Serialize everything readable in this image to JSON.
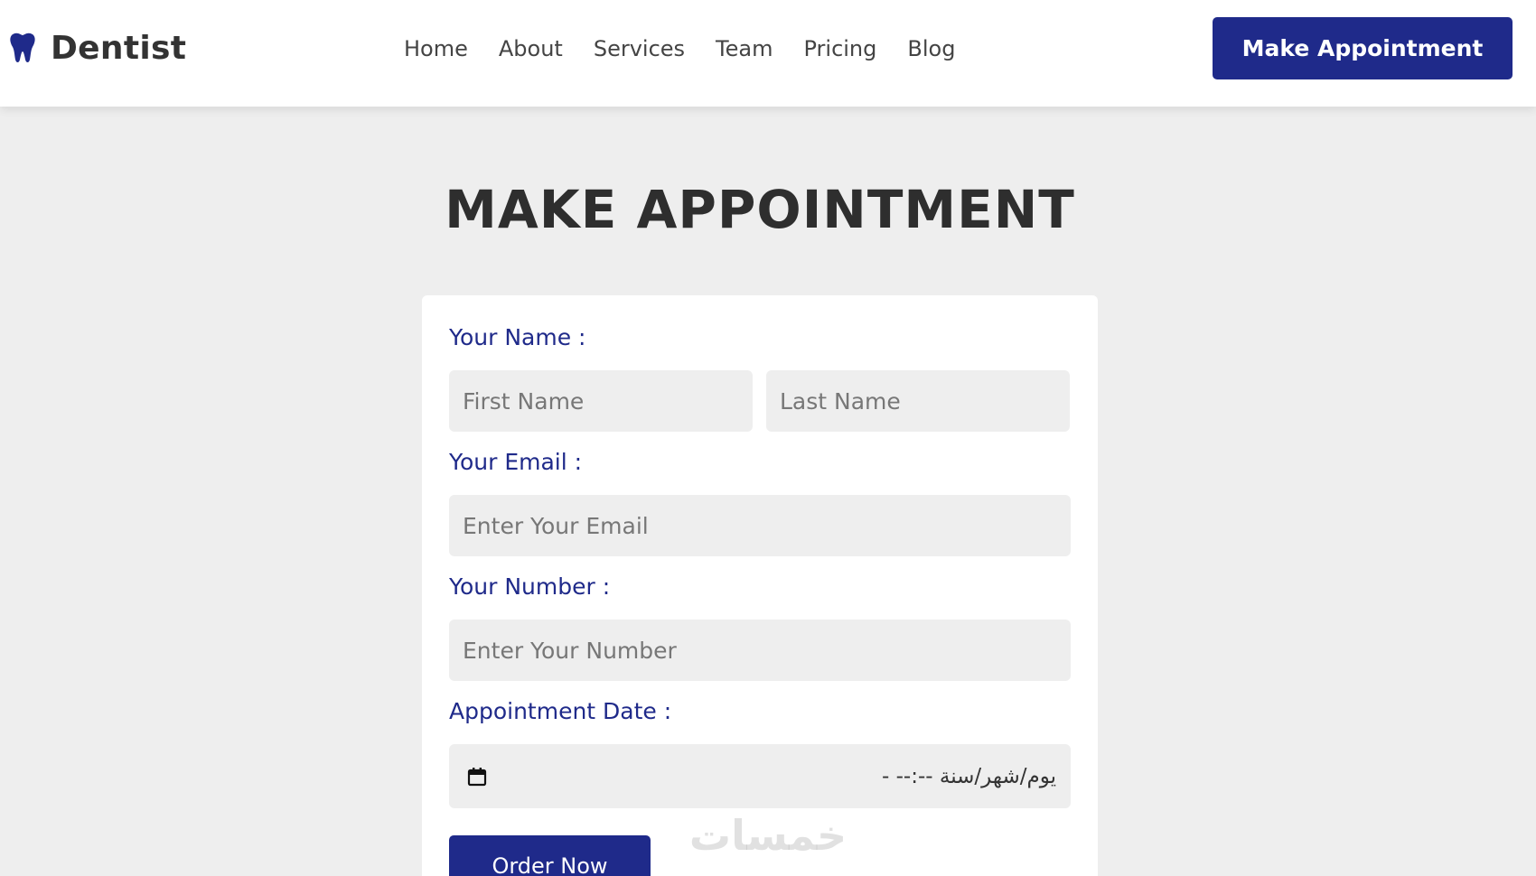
{
  "nav": {
    "brand": "Dentist",
    "brand_icon": "tooth-icon",
    "links": [
      "Home",
      "About",
      "Services",
      "Team",
      "Pricing",
      "Blog"
    ],
    "cta_label": "Make Appointment"
  },
  "page": {
    "title": "MAKE APPOINTMENT"
  },
  "form": {
    "name_label": "Your Name :",
    "first_name_placeholder": "First Name",
    "last_name_placeholder": "Last Name",
    "email_label": "Your Email :",
    "email_placeholder": "Enter Your Email",
    "number_label": "Your Number :",
    "number_placeholder": "Enter Your Number",
    "date_label": "Appointment Date :",
    "date_value": "يوم/شهر/سنة --:-- -",
    "calendar_icon": "calendar-icon",
    "submit_label": "Order Now"
  },
  "watermark": "خمسات",
  "colors": {
    "brand": "#1f2a8a",
    "page_bg": "#eeeeee",
    "heading": "#2e2e2e"
  }
}
